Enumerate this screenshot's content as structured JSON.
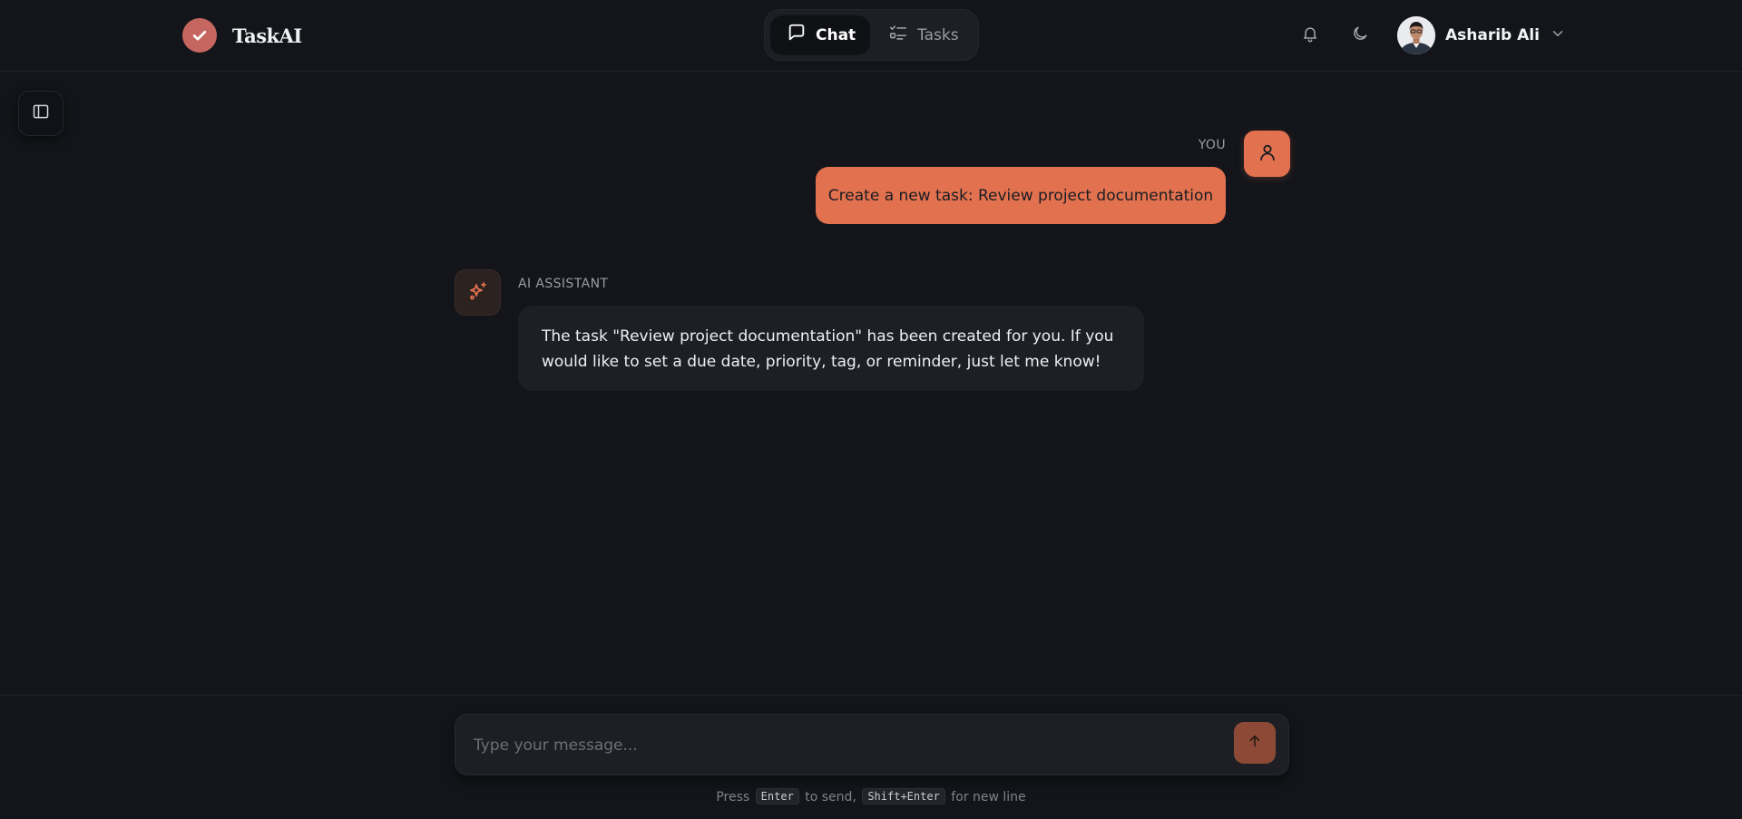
{
  "app": {
    "name": "TaskAI"
  },
  "nav": {
    "tabs": [
      {
        "label": "Chat",
        "active": true,
        "icon": "chat-bubble-icon"
      },
      {
        "label": "Tasks",
        "active": false,
        "icon": "checklist-icon"
      }
    ]
  },
  "header": {
    "notifications_icon": "bell-icon",
    "theme_icon": "moon-icon",
    "user": {
      "name": "Asharib Ali",
      "menu_icon": "chevron-down-icon"
    }
  },
  "sidebar": {
    "toggle_icon": "sidebar-panel-icon"
  },
  "messages": [
    {
      "role": "user",
      "label": "YOU",
      "text": "Create a new task: Review project documentation"
    },
    {
      "role": "assistant",
      "label": "AI ASSISTANT",
      "text": "The task \"Review project documentation\" has been created for you. If you would like to set a due date, priority, tag, or reminder, just let me know!"
    }
  ],
  "composer": {
    "placeholder": "Type your message...",
    "value": "",
    "send_icon": "arrow-up-icon"
  },
  "hint": {
    "prefix": "Press",
    "key_send": "Enter",
    "middle": "to send,",
    "key_newline": "Shift+Enter",
    "suffix": "for new line"
  },
  "colors": {
    "background": "#13151a",
    "accent": "#e2714f",
    "brand_logo": "#c56660",
    "bubble_ai": "#1d1f25",
    "send_button": "#8c4a36"
  }
}
